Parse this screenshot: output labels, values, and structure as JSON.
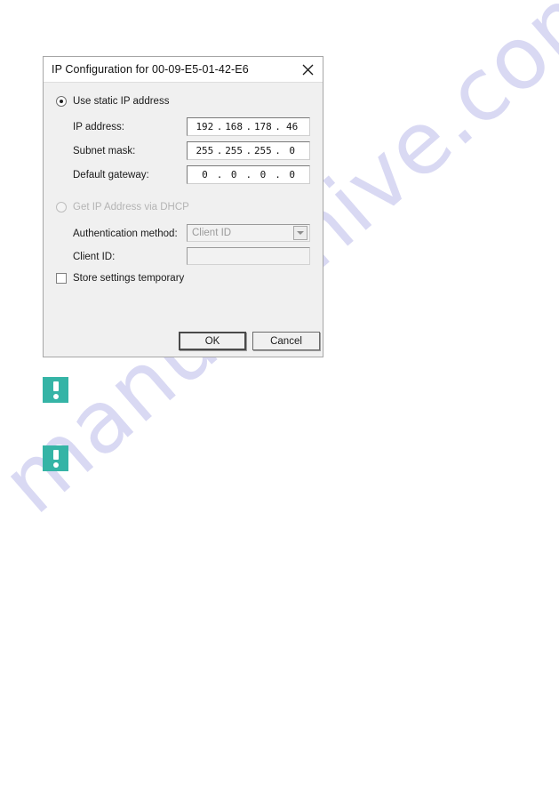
{
  "page": {
    "background_color": "#ffffff",
    "watermark_text": "manualshive.com",
    "watermark_color": "#d6d6f2"
  },
  "dialog": {
    "title": "IP Configuration for  00-09-E5-01-42-E6",
    "close_icon": "close-icon",
    "accent_disabled_color": "#b4b4b4",
    "static_ip": {
      "radio_label": "Use static IP address",
      "selected": true
    },
    "fields": [
      {
        "label": "IP address:",
        "octets": [
          "192",
          "168",
          "178",
          "46"
        ],
        "value": "192.168.178.46"
      },
      {
        "label": "Subnet mask:",
        "octets": [
          "255",
          "255",
          "255",
          "0"
        ],
        "value": "255.255.255.0"
      },
      {
        "label": "Default gateway:",
        "octets": [
          "0",
          "0",
          "0",
          "0"
        ],
        "value": "0.0.0.0"
      }
    ],
    "dhcp": {
      "radio_label": "Get IP Address via DHCP",
      "selected": false,
      "disabled": true
    },
    "auth_method": {
      "label": "Authentication method:",
      "value": "Client ID",
      "disabled": true
    },
    "client_id": {
      "label": "Client ID:",
      "value": "",
      "disabled": true
    },
    "store_settings": {
      "label": "Store settings temporary",
      "checked": false
    },
    "buttons": {
      "ok": "OK",
      "cancel": "Cancel"
    }
  },
  "notes": {
    "icon_color": "#35b4a6",
    "items": [
      {
        "icon": "exclamation-icon"
      },
      {
        "icon": "exclamation-icon"
      }
    ]
  },
  "dot_separator": "."
}
